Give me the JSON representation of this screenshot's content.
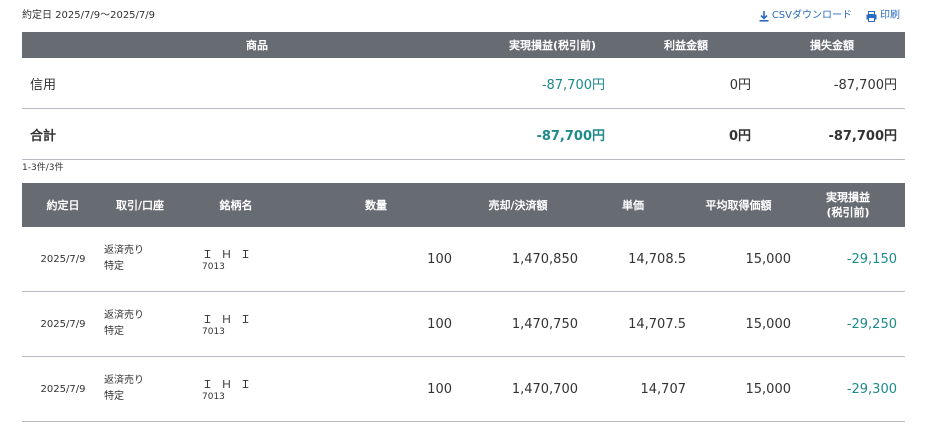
{
  "header": {
    "date_range": "約定日 2025/7/9～2025/7/9",
    "csv_label": "CSVダウンロード",
    "print_label": "印刷"
  },
  "summary": {
    "columns": [
      "商品",
      "実現損益(税引前)",
      "利益金額",
      "損失金額"
    ],
    "rows": [
      {
        "label": "信用",
        "realized": "-87,700円",
        "profit": "0円",
        "loss": "-87,700円"
      }
    ],
    "total": {
      "label": "合計",
      "realized": "-87,700円",
      "profit": "0円",
      "loss": "-87,700円"
    }
  },
  "count_text": "1-3件/3件",
  "detail": {
    "columns": {
      "date": "約定日",
      "trade": "取引/口座",
      "name": "銘柄名",
      "qty": "数量",
      "amount": "売却/決済額",
      "price": "単価",
      "avg": "平均取得価額",
      "pnl1": "実現損益",
      "pnl2": "(税引前)"
    },
    "rows": [
      {
        "date": "2025/7/9",
        "trade": "返済売り",
        "account": "特定",
        "name": "ＩＨＩ",
        "code": "7013",
        "qty": "100",
        "amount": "1,470,850",
        "price": "14,708.5",
        "avg": "15,000",
        "pnl": "-29,150"
      },
      {
        "date": "2025/7/9",
        "trade": "返済売り",
        "account": "特定",
        "name": "ＩＨＩ",
        "code": "7013",
        "qty": "100",
        "amount": "1,470,750",
        "price": "14,707.5",
        "avg": "15,000",
        "pnl": "-29,250"
      },
      {
        "date": "2025/7/9",
        "trade": "返済売り",
        "account": "特定",
        "name": "ＩＨＩ",
        "code": "7013",
        "qty": "100",
        "amount": "1,470,700",
        "price": "14,707",
        "avg": "15,000",
        "pnl": "-29,300"
      }
    ]
  },
  "colors": {
    "header_bg": "#676b72",
    "loss_text": "#1e8a8a",
    "link": "#2a6bbf"
  },
  "icons": {
    "csv": "download-icon",
    "print": "printer-icon"
  }
}
